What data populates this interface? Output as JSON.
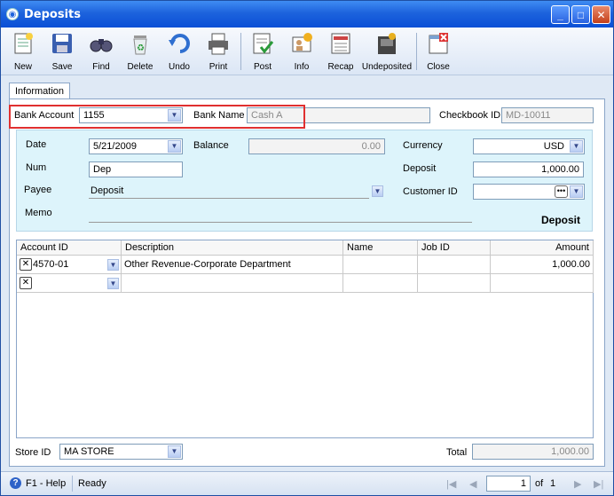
{
  "window": {
    "title": "Deposits"
  },
  "toolbar": {
    "items": [
      {
        "label": "New",
        "icon": "new-icon"
      },
      {
        "label": "Save",
        "icon": "save-icon"
      },
      {
        "label": "Find",
        "icon": "find-icon"
      },
      {
        "label": "Delete",
        "icon": "delete-icon"
      },
      {
        "label": "Undo",
        "icon": "undo-icon"
      },
      {
        "label": "Print",
        "icon": "print-icon"
      },
      {
        "label": "Post",
        "icon": "post-icon"
      },
      {
        "label": "Info",
        "icon": "info-icon"
      },
      {
        "label": "Recap",
        "icon": "recap-icon"
      },
      {
        "label": "Undeposited",
        "icon": "undeposited-icon"
      },
      {
        "label": "Close",
        "icon": "close-icon"
      }
    ]
  },
  "tab": {
    "label": "Information"
  },
  "header": {
    "bank_account_label": "Bank Account",
    "bank_account_value": "1155",
    "bank_name_label": "Bank Name",
    "bank_name_value": "Cash A",
    "checkbook_label": "Checkbook ID",
    "checkbook_value": "MD-10011"
  },
  "detail": {
    "date_label": "Date",
    "date_value": "5/21/2009",
    "balance_label": "Balance",
    "balance_value": "0.00",
    "currency_label": "Currency",
    "currency_value": "USD",
    "num_label": "Num",
    "num_value": "Dep",
    "deposit_label": "Deposit",
    "deposit_value": "1,000.00",
    "payee_label": "Payee",
    "payee_value": "Deposit",
    "customer_label": "Customer ID",
    "customer_value": "",
    "memo_label": "Memo",
    "memo_value": "",
    "type_caption": "Deposit"
  },
  "grid": {
    "columns": [
      "Account ID",
      "Description",
      "Name",
      "Job ID",
      "Amount"
    ],
    "rows": [
      {
        "account": "4570-01",
        "description": "Other Revenue-Corporate Department",
        "name": "",
        "job": "",
        "amount": "1,000.00"
      },
      {
        "account": "",
        "description": "",
        "name": "",
        "job": "",
        "amount": ""
      }
    ]
  },
  "footer": {
    "store_label": "Store ID",
    "store_value": "MA STORE",
    "total_label": "Total",
    "total_value": "1,000.00"
  },
  "status": {
    "help": "F1 - Help",
    "state": "Ready",
    "page": "1",
    "of_label": "of",
    "total_pages": "1"
  }
}
